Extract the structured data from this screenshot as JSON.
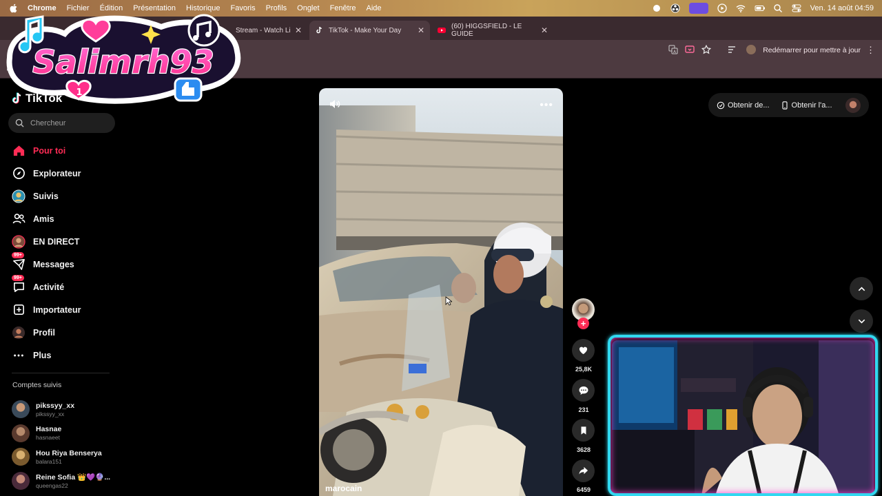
{
  "menubar": {
    "app": "Chrome",
    "items": [
      "Fichier",
      "Édition",
      "Présentation",
      "Historique",
      "Favoris",
      "Profils",
      "Onglet",
      "Fenêtre",
      "Aide"
    ],
    "datetime": "Ven. 14 août  04:59"
  },
  "tabs": [
    {
      "title": "Stream - Watch Li",
      "active": false
    },
    {
      "title": "TikTok - Make Your Day",
      "active": true
    },
    {
      "title": "(60) HIGGSFIELD - LE GUIDE",
      "active": false
    }
  ],
  "toolbar": {
    "restart_label": "Redémarrer pour mettre à jour"
  },
  "overlay_logo": {
    "text": "Salimrh93",
    "heart_badge": "1"
  },
  "sidebar": {
    "brand": "TikTok",
    "search_placeholder": "Chercheur",
    "nav": [
      {
        "label": "Pour toi",
        "icon": "home-icon",
        "active": true,
        "badge": ""
      },
      {
        "label": "Explorateur",
        "icon": "compass-icon",
        "active": false,
        "badge": ""
      },
      {
        "label": "Suivis",
        "icon": "following-avatar-icon",
        "active": false,
        "badge": ""
      },
      {
        "label": "Amis",
        "icon": "friends-icon",
        "active": false,
        "badge": ""
      },
      {
        "label": "EN DIRECT",
        "icon": "live-avatar-icon",
        "active": false,
        "badge": ""
      },
      {
        "label": "Messages",
        "icon": "messages-icon",
        "active": false,
        "badge": "99+"
      },
      {
        "label": "Activité",
        "icon": "activity-icon",
        "active": false,
        "badge": "99+"
      },
      {
        "label": "Importateur",
        "icon": "upload-icon",
        "active": false,
        "badge": ""
      },
      {
        "label": "Profil",
        "icon": "profile-avatar-icon",
        "active": false,
        "badge": ""
      },
      {
        "label": "Plus",
        "icon": "more-icon",
        "active": false,
        "badge": ""
      }
    ],
    "followed_title": "Comptes suivis",
    "followed": [
      {
        "name": "pikssyy_xx",
        "handle": "pikssyy_xx"
      },
      {
        "name": "Hasnae",
        "handle": "hasnaeet"
      },
      {
        "name": "Hou Riya Benserya",
        "handle": "balara151"
      },
      {
        "name": "Reine Sofia 👑💜🔮...",
        "handle": "queengas22"
      }
    ]
  },
  "video": {
    "author": "marocain"
  },
  "actions": {
    "likes": "25,8K",
    "comments": "231",
    "saves": "3628",
    "shares": "6459"
  },
  "topright": {
    "coins_label": "Obtenir de...",
    "app_label": "Obtenir l'a..."
  },
  "colors": {
    "accent": "#fe2c55",
    "webcam_border": "#31d8f0"
  }
}
